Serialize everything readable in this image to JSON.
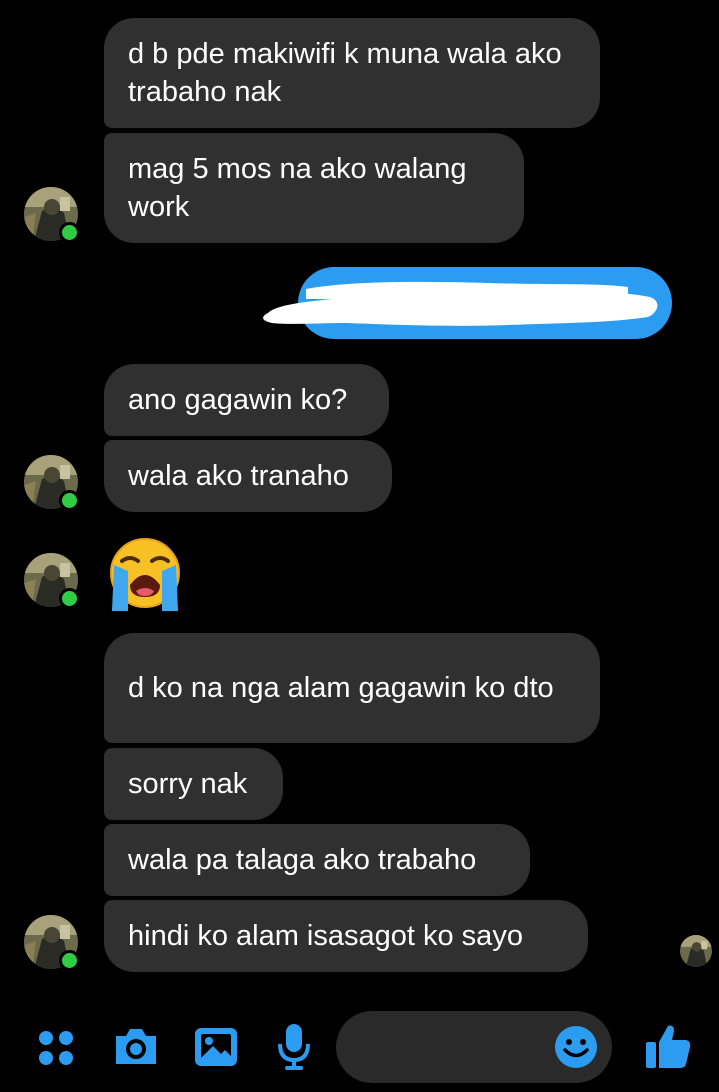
{
  "messages": [
    {
      "text": "d b pde makiwifi k muna wala ako trabaho nak"
    },
    {
      "text": "mag 5 mos na ako walang work"
    },
    {
      "text": "ano gagawin ko?"
    },
    {
      "text": "wala ako tranaho"
    },
    {
      "text": "d ko na nga alam gagawin ko dto"
    },
    {
      "text": "sorry nak"
    },
    {
      "text": "wala pa talaga ako trabaho"
    },
    {
      "text": "hindi ko alam isasagot ko sayo"
    }
  ],
  "emoji_message": {
    "icon": "loudly-crying-face-emoji"
  },
  "sent_message": {
    "redacted": true
  },
  "toolbar": {
    "icons": [
      "apps-grid-icon",
      "camera-icon",
      "gallery-icon",
      "microphone-icon",
      "smiley-icon",
      "thumbs-up-icon"
    ]
  },
  "colors": {
    "accent": "#2c9cf0",
    "bubble": "#303030",
    "online": "#31cc46",
    "background": "#000000"
  }
}
